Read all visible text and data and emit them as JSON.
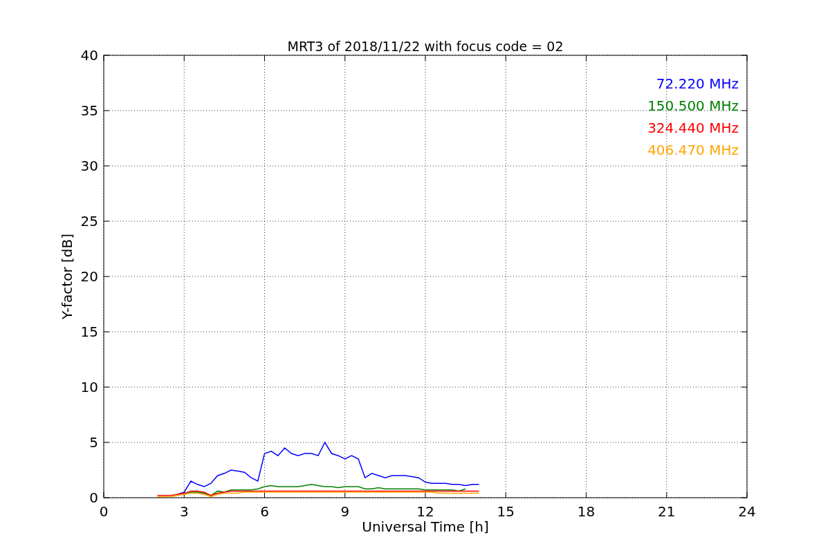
{
  "chart_data": {
    "type": "line",
    "title": "MRT3 of 2018/11/22 with focus code = 02",
    "xlabel": "Universal Time [h]",
    "ylabel": "Y-factor [dB]",
    "x": [
      2,
      2.25,
      2.5,
      2.75,
      3,
      3.25,
      3.5,
      3.75,
      4,
      4.25,
      4.5,
      4.75,
      5,
      5.25,
      5.5,
      5.75,
      6,
      6.25,
      6.5,
      6.75,
      7,
      7.25,
      7.5,
      7.75,
      8,
      8.25,
      8.5,
      8.75,
      9,
      9.25,
      9.5,
      9.75,
      10,
      10.25,
      10.5,
      10.75,
      11,
      11.25,
      11.5,
      11.75,
      12,
      12.25,
      12.5,
      12.75,
      13,
      13.25,
      13.5,
      13.75,
      14
    ],
    "series": [
      {
        "name": "72.220 MHz",
        "color": "#0000ff",
        "values": [
          null,
          null,
          null,
          0.3,
          0.5,
          1.5,
          1.2,
          1.0,
          1.3,
          2.0,
          2.2,
          2.5,
          2.4,
          2.3,
          1.8,
          1.5,
          4.0,
          4.2,
          3.8,
          4.5,
          4.0,
          3.8,
          4.0,
          4.0,
          3.8,
          5.0,
          4.0,
          3.8,
          3.5,
          3.8,
          3.5,
          1.8,
          2.2,
          2.0,
          1.8,
          2.0,
          2.0,
          2.0,
          1.9,
          1.8,
          1.4,
          1.3,
          1.3,
          1.3,
          1.2,
          1.2,
          1.1,
          1.2,
          1.2
        ]
      },
      {
        "name": "150.500 MHz",
        "color": "#008000",
        "values": [
          null,
          null,
          null,
          null,
          0.4,
          0.5,
          0.5,
          0.4,
          0.2,
          0.6,
          0.5,
          0.7,
          0.7,
          0.7,
          0.7,
          0.8,
          1.0,
          1.1,
          1.0,
          1.0,
          1.0,
          1.0,
          1.1,
          1.2,
          1.1,
          1.0,
          1.0,
          0.9,
          1.0,
          1.0,
          1.0,
          0.8,
          0.8,
          0.9,
          0.8,
          0.8,
          0.8,
          0.8,
          0.8,
          0.8,
          0.7,
          0.7,
          0.7,
          0.7,
          0.7,
          0.6,
          0.8,
          null,
          null
        ]
      },
      {
        "name": "324.440 MHz",
        "color": "#ff0000",
        "values": [
          0.2,
          0.2,
          0.2,
          0.3,
          0.4,
          0.6,
          0.6,
          0.5,
          0.2,
          0.4,
          0.5,
          0.6,
          0.6,
          0.6,
          0.6,
          0.6,
          0.6,
          0.6,
          0.6,
          0.6,
          0.6,
          0.6,
          0.6,
          0.6,
          0.6,
          0.6,
          0.6,
          0.6,
          0.6,
          0.6,
          0.6,
          0.6,
          0.6,
          0.6,
          0.6,
          0.6,
          0.6,
          0.6,
          0.6,
          0.6,
          0.6,
          0.6,
          0.6,
          0.6,
          0.6,
          0.6,
          0.6,
          0.6,
          0.6
        ]
      },
      {
        "name": "406.470 MHz",
        "color": "#ffa500",
        "values": [
          0.1,
          0.1,
          0.1,
          0.2,
          0.3,
          0.4,
          0.4,
          0.3,
          0.1,
          0.3,
          0.4,
          0.4,
          0.4,
          0.5,
          0.5,
          0.5,
          0.5,
          0.5,
          0.5,
          0.5,
          0.5,
          0.5,
          0.5,
          0.5,
          0.5,
          0.5,
          0.5,
          0.5,
          0.5,
          0.5,
          0.5,
          0.5,
          0.5,
          0.5,
          0.5,
          0.5,
          0.5,
          0.5,
          0.5,
          0.5,
          0.5,
          0.5,
          0.4,
          0.4,
          0.4,
          0.4,
          0.4,
          0.4,
          0.4
        ]
      }
    ],
    "grid": true,
    "xlim": [
      0,
      24
    ],
    "ylim": [
      0,
      40
    ],
    "xticks": [
      0,
      3,
      6,
      9,
      12,
      15,
      18,
      21,
      24
    ],
    "yticks": [
      0,
      5,
      10,
      15,
      20,
      25,
      30,
      35,
      40
    ]
  }
}
